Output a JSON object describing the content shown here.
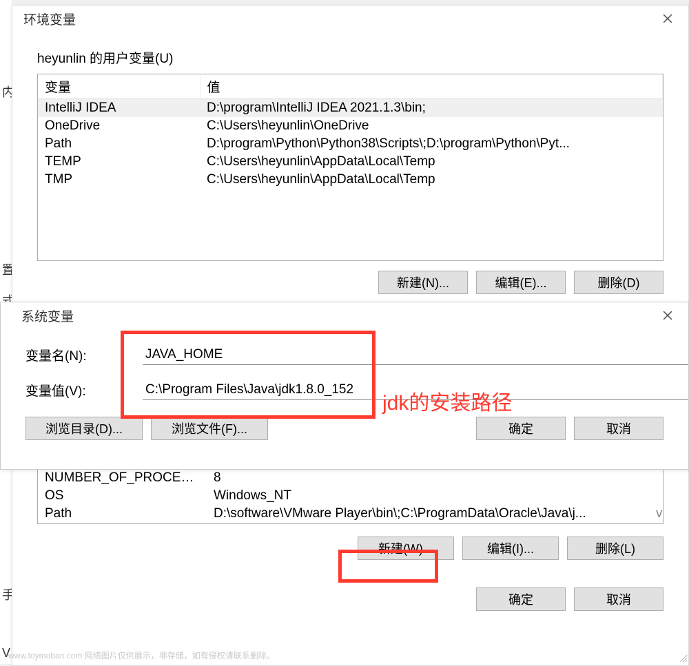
{
  "bg_chars": [
    "内",
    "置",
    "式",
    "手",
    "V"
  ],
  "env_window": {
    "title": "环境变量",
    "user_section_label": "heyunlin 的用户变量(U)",
    "columns": {
      "var": "变量",
      "val": "值"
    },
    "user_rows": [
      {
        "var": "IntelliJ IDEA",
        "val": "D:\\program\\IntelliJ IDEA 2021.1.3\\bin;"
      },
      {
        "var": "OneDrive",
        "val": "C:\\Users\\heyunlin\\OneDrive"
      },
      {
        "var": "Path",
        "val": "D:\\program\\Python\\Python38\\Scripts\\;D:\\program\\Python\\Pyt..."
      },
      {
        "var": "TEMP",
        "val": "C:\\Users\\heyunlin\\AppData\\Local\\Temp"
      },
      {
        "var": "TMP",
        "val": "C:\\Users\\heyunlin\\AppData\\Local\\Temp"
      }
    ],
    "user_buttons": {
      "new": "新建(N)...",
      "edit": "编辑(E)...",
      "delete": "删除(D)"
    },
    "system_rows": [
      {
        "var": "NUMBER_OF_PROCESSORS",
        "val": "8"
      },
      {
        "var": "OS",
        "val": "Windows_NT"
      },
      {
        "var": "Path",
        "val": "D:\\software\\VMware Player\\bin\\;C:\\ProgramData\\Oracle\\Java\\j..."
      }
    ],
    "scroll_hint": "v",
    "system_buttons": {
      "new": "新建(W)...",
      "edit": "编辑(I)...",
      "delete": "删除(L)"
    },
    "final_buttons": {
      "ok": "确定",
      "cancel": "取消"
    }
  },
  "sys_var_window": {
    "title": "系统变量",
    "name_label": "变量名(N):",
    "name_value": "JAVA_HOME",
    "value_label": "变量值(V):",
    "value_value": "C:\\Program Files\\Java\\jdk1.8.0_152",
    "buttons": {
      "browse_dir": "浏览目录(D)...",
      "browse_file": "浏览文件(F)...",
      "ok": "确定",
      "cancel": "取消"
    }
  },
  "annotation_text": "jdk的安装路径",
  "watermark": "www.toymoban.com  网络图片仅供展示，非存储，如有侵权请联系删除。"
}
